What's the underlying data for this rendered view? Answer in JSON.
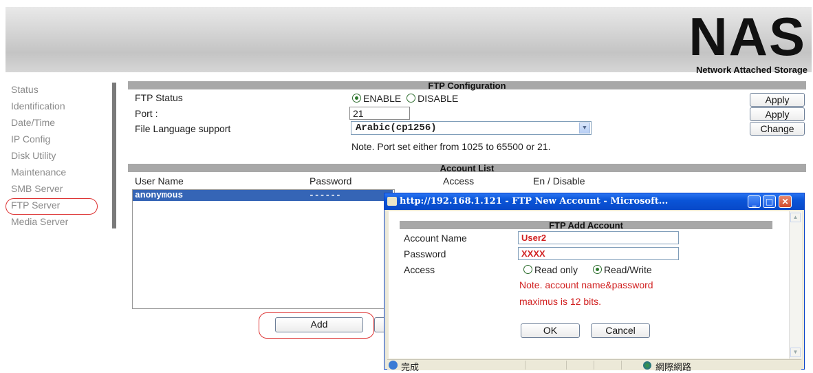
{
  "header": {
    "logo_text": "NAS",
    "logo_subtitle": "Network Attached Storage"
  },
  "sidebar": {
    "items": [
      {
        "label": "Status"
      },
      {
        "label": "Identification"
      },
      {
        "label": "Date/Time"
      },
      {
        "label": "IP Config"
      },
      {
        "label": "Disk Utility"
      },
      {
        "label": "Maintenance"
      },
      {
        "label": "SMB Server"
      },
      {
        "label": "FTP Server"
      },
      {
        "label": "Media Server"
      }
    ]
  },
  "ftp_config": {
    "title": "FTP Configuration",
    "status_label": "FTP Status",
    "enable_label": "ENABLE",
    "disable_label": "DISABLE",
    "status_selected": "ENABLE",
    "port_label": "Port :",
    "port_value": "21",
    "language_label": "File Language support",
    "language_value": "Arabic(cp1256)",
    "note": "Note. Port set either from 1025 to 65500 or 21.",
    "apply_label": "Apply",
    "change_label": "Change"
  },
  "account_list": {
    "title": "Account List",
    "columns": [
      "User Name",
      "Password",
      "Access",
      "En / Disable"
    ],
    "rows": [
      {
        "user": "anonymous",
        "password": "------"
      }
    ],
    "add_label": "Add"
  },
  "popup": {
    "title": "http://192.168.1.121 - FTP New Account - Microsoft...",
    "heading": "FTP Add Account",
    "account_name_label": "Account Name",
    "account_name_value": "User2",
    "password_label": "Password",
    "password_value": "XXXX",
    "access_label": "Access",
    "read_only_label": "Read only",
    "read_write_label": "Read/Write",
    "access_selected": "Read/Write",
    "note_line1": "Note. account name&password",
    "note_line2": "maximus is 12 bits.",
    "ok_label": "OK",
    "cancel_label": "Cancel",
    "status_done": "完成",
    "status_zone": "網際網路"
  },
  "colors": {
    "accent_red": "#d12020",
    "selection_blue": "#3565b6",
    "titlebar_blue": "#0a55d8"
  }
}
